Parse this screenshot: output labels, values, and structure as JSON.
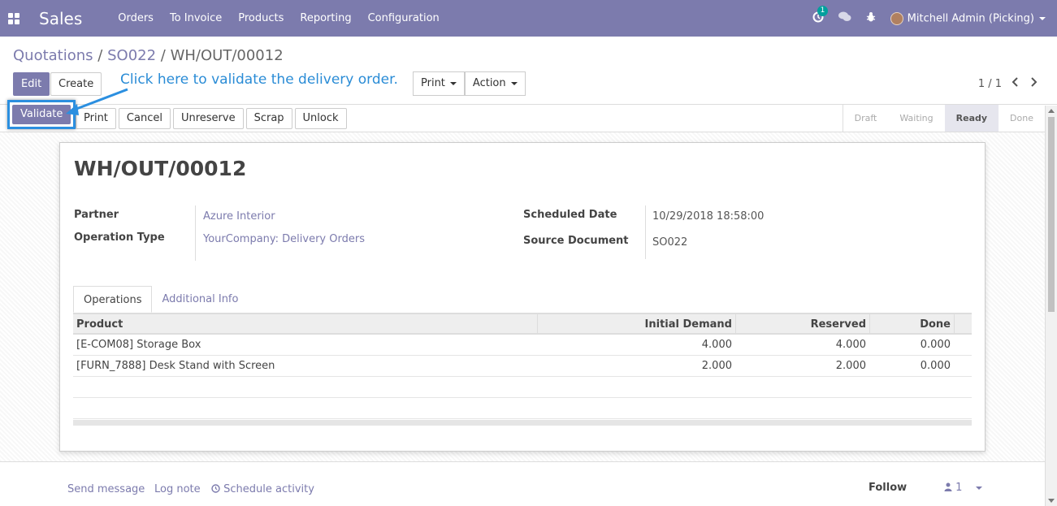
{
  "navbar": {
    "app_name": "Sales",
    "menu": [
      "Orders",
      "To Invoice",
      "Products",
      "Reporting",
      "Configuration"
    ],
    "activity_count": "1",
    "user": "Mitchell Admin (Picking)"
  },
  "breadcrumb": {
    "parts": [
      "Quotations",
      "SO022",
      "WH/OUT/00012"
    ],
    "separator": "/"
  },
  "control": {
    "edit": "Edit",
    "create": "Create",
    "print": "Print",
    "action": "Action",
    "pager": "1 / 1"
  },
  "callout": "Click here to validate the delivery order.",
  "statusbar": {
    "buttons": [
      "Validate",
      "Print",
      "Cancel",
      "Unreserve",
      "Scrap",
      "Unlock"
    ],
    "states": [
      "Draft",
      "Waiting",
      "Ready",
      "Done"
    ],
    "active_state": "Ready"
  },
  "record": {
    "name": "WH/OUT/00012",
    "partner_label": "Partner",
    "partner": "Azure Interior",
    "operation_type_label": "Operation Type",
    "operation_type": "YourCompany: Delivery Orders",
    "scheduled_date_label": "Scheduled Date",
    "scheduled_date": "10/29/2018 18:58:00",
    "source_document_label": "Source Document",
    "source_document": "SO022"
  },
  "tabs": [
    "Operations",
    "Additional Info"
  ],
  "operations": {
    "columns": [
      "Product",
      "Initial Demand",
      "Reserved",
      "Done"
    ],
    "rows": [
      [
        "[E-COM08] Storage Box",
        "4.000",
        "4.000",
        "0.000"
      ],
      [
        "[FURN_7888] Desk Stand with Screen",
        "2.000",
        "2.000",
        "0.000"
      ]
    ]
  },
  "chatter": {
    "send_message": "Send message",
    "log_note": "Log note",
    "schedule_activity": "Schedule activity",
    "follow": "Follow",
    "followers_count": "1"
  },
  "colors": {
    "brand": "#7c7bad",
    "callout": "#2a8cd6",
    "highlight_border": "#2b8fe0"
  }
}
